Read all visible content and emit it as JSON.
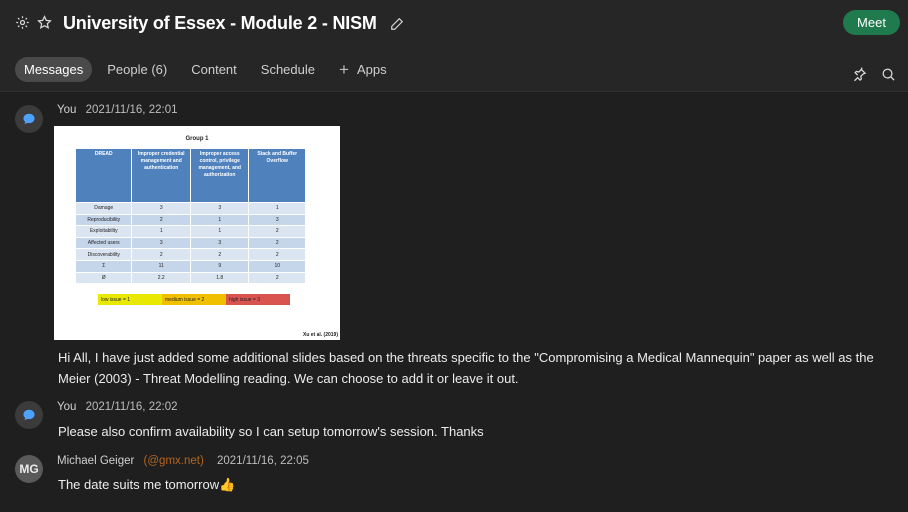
{
  "header": {
    "title": "University of Essex - Module 2 - NISM",
    "meet_label": "Meet",
    "icons": [
      "gear-icon",
      "star-icon",
      "pencil-icon",
      "pin-icon",
      "search-icon"
    ]
  },
  "tabs": [
    {
      "label": "Messages",
      "active": true
    },
    {
      "label": "People (6)",
      "active": false
    },
    {
      "label": "Content",
      "active": false
    },
    {
      "label": "Schedule",
      "active": false
    },
    {
      "label": "Apps",
      "active": false
    }
  ],
  "messages": [
    {
      "author": "You",
      "time": "2021/11/16, 22:01",
      "text": "Hi All, I have just added some additional slides based on the threats specific to the \"Compromising a Medical Mannequin\" paper as well as the Meier (2003) - Threat Modelling reading. We can choose to add it or leave it out.",
      "attachment": {
        "title": "Group 1",
        "headers": [
          "DREAD",
          "Improper credential management and authentication",
          "Improper access control, privilege management, and authorization",
          "Stack and Buffer Overflow"
        ],
        "rows": [
          [
            "Damage",
            "3",
            "3",
            "1"
          ],
          [
            "Reproducibility",
            "2",
            "1",
            "3"
          ],
          [
            "Exploitability",
            "1",
            "1",
            "2"
          ],
          [
            "Affected users",
            "3",
            "3",
            "2"
          ],
          [
            "Discoverability",
            "2",
            "2",
            "2"
          ],
          [
            "Σ",
            "11",
            "9",
            "10"
          ],
          [
            "Ø",
            "2.2",
            "1.8",
            "2"
          ]
        ],
        "legend": [
          {
            "label": "low issue = 1",
            "color": "#e8e800"
          },
          {
            "label": "medium issue = 2",
            "color": "#f0c000"
          },
          {
            "label": "high issue = 3",
            "color": "#d9534f"
          }
        ],
        "citation": "Xu et al. (2019)"
      }
    },
    {
      "author": "You",
      "time": "2021/11/16, 22:02",
      "text": "Please also confirm availability so I can setup tomorrow's session. Thanks"
    },
    {
      "author": "Michael Geiger",
      "email": "(@gmx.net)",
      "initials": "MG",
      "time": "2021/11/16, 22:05",
      "text": "The date suits me tomorrow👍"
    }
  ]
}
